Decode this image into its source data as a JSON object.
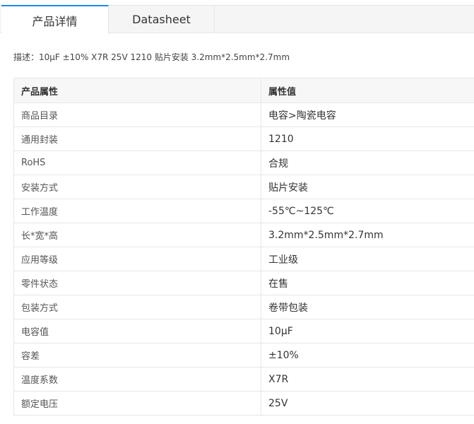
{
  "tabs": [
    {
      "label": "产品详情",
      "active": true
    },
    {
      "label": "Datasheet",
      "active": false
    }
  ],
  "description": "描述：10μF ±10% X7R 25V 1210 贴片安装 3.2mm*2.5mm*2.7mm",
  "table": {
    "headers": [
      "产品属性",
      "属性值"
    ],
    "rows": [
      {
        "name": "商品目录",
        "value": "电容>陶瓷电容"
      },
      {
        "name": "通用封装",
        "value": "1210"
      },
      {
        "name": "RoHS",
        "value": "合规"
      },
      {
        "name": "安装方式",
        "value": "贴片安装"
      },
      {
        "name": "工作温度",
        "value": "-55℃~125℃"
      },
      {
        "name": "长*宽*高",
        "value": "3.2mm*2.5mm*2.7mm"
      },
      {
        "name": "应用等级",
        "value": "工业级"
      },
      {
        "name": "零件状态",
        "value": "在售"
      },
      {
        "name": "包装方式",
        "value": "卷带包装"
      },
      {
        "name": "电容值",
        "value": "10μF"
      },
      {
        "name": "容差",
        "value": "±10%"
      },
      {
        "name": "温度系数",
        "value": "X7R"
      },
      {
        "name": "额定电压",
        "value": "25V"
      }
    ]
  },
  "colors": {
    "accent": "#1e88e5",
    "border": "#e6e6e6",
    "header_bg": "#f7f7f7",
    "tabbar_bg": "#f5f5f5"
  }
}
